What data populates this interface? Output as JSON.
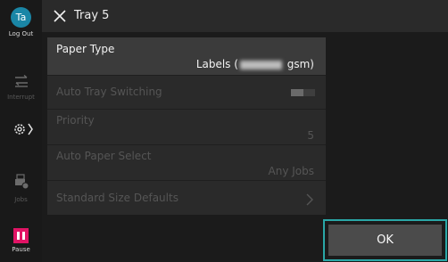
{
  "sidebar": {
    "user_initials": "Ta",
    "logout_label": "Log Out",
    "interrupt_label": "Interrupt",
    "jobs_label": "Jobs",
    "pause_label": "Pause"
  },
  "header": {
    "title": "Tray 5"
  },
  "settings": {
    "paper_type": {
      "label": "Paper Type",
      "value_prefix": "Labels (",
      "value_suffix": " gsm)"
    },
    "auto_tray_switching": {
      "label": "Auto Tray Switching",
      "enabled": false
    },
    "priority": {
      "label": "Priority",
      "value": "5"
    },
    "auto_paper_select": {
      "label": "Auto Paper Select",
      "value": "Any Jobs"
    },
    "standard_size_defaults": {
      "label": "Standard Size Defaults"
    }
  },
  "footer": {
    "ok_label": "OK"
  },
  "colors": {
    "accent_teal": "#2aa7a7",
    "avatar": "#1a86a6",
    "pause": "#e11465"
  }
}
